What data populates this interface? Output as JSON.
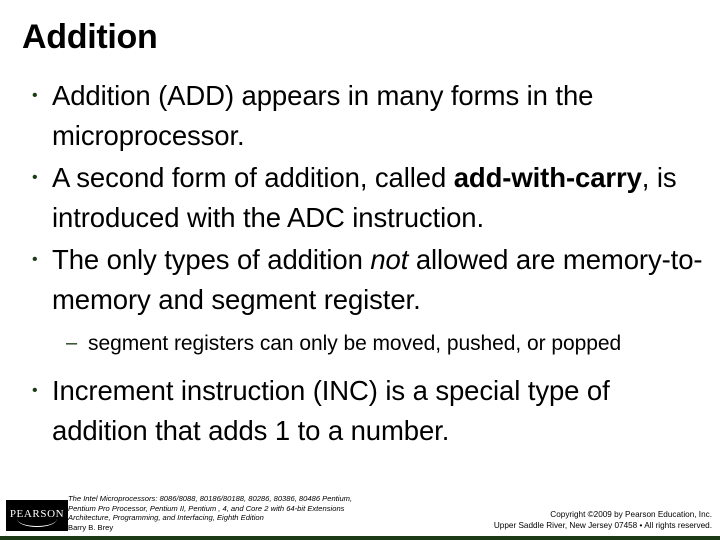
{
  "slide": {
    "title": "Addition",
    "bullet_marker": "•",
    "subbullet_marker": "–",
    "accent_color": "#1d3a17",
    "background_color": "#ffffff",
    "text_color": "#000000"
  },
  "bullets": [
    {
      "level": 1,
      "text": "Addition (ADD) appears in many forms in the microprocessor.",
      "parts": [
        {
          "text": "Addition (ADD) appears in many forms in the microprocessor.",
          "style": "normal"
        }
      ]
    },
    {
      "level": 1,
      "text": "A second form of addition, called add-with-carry, is introduced with the ADC instruction.",
      "parts": [
        {
          "text": "A second form of addition, called ",
          "style": "normal"
        },
        {
          "text": "add-with-carry",
          "style": "bold"
        },
        {
          "text": ", is introduced with the ADC instruction.",
          "style": "normal"
        }
      ]
    },
    {
      "level": 1,
      "text": "The only types of addition not allowed are memory-to-memory and segment register.",
      "parts": [
        {
          "text": "The only types of addition ",
          "style": "normal"
        },
        {
          "text": "not",
          "style": "italic"
        },
        {
          "text": " allowed are memory-to-memory and segment register.",
          "style": "normal"
        }
      ]
    },
    {
      "level": 2,
      "text": "segment registers can only be moved, pushed, or popped",
      "parts": [
        {
          "text": "segment registers can only be moved, pushed, or popped",
          "style": "normal"
        }
      ]
    },
    {
      "level": 1,
      "text": "Increment instruction (INC) is a special type of addition that adds 1 to a number.",
      "parts": [
        {
          "text": "Increment instruction (INC) is a special type of addition that adds 1 to a number.",
          "style": "normal"
        }
      ]
    }
  ],
  "footer": {
    "logo_text": "PEARSON",
    "book_credit_lines": [
      "The Intel Microprocessors: 8086/8088, 80186/80188, 80286, 80386, 80486 Pentium,",
      "Pentium Pro Processor, Pentium II, Pentium , 4, and Core 2 with 64-bit Extensions",
      "Architecture, Programming, and Interfacing, Eighth Edition"
    ],
    "author": "Barry B. Brey",
    "copyright_lines": [
      "Copyright ©2009 by Pearson Education, Inc.",
      "Upper Saddle River, New Jersey 07458 • All rights reserved."
    ]
  }
}
